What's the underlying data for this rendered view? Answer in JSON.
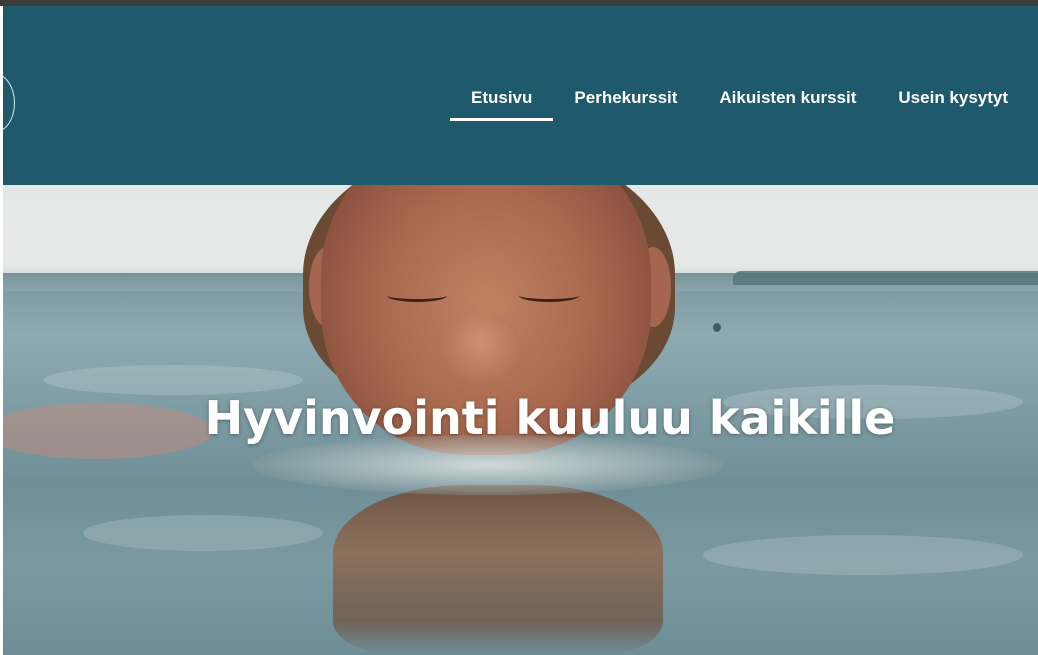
{
  "nav": {
    "items": [
      {
        "label": "Etusivu",
        "active": true
      },
      {
        "label": "Perhekurssit",
        "active": false
      },
      {
        "label": "Aikuisten kurssit",
        "active": false
      },
      {
        "label": "Usein kysytyt",
        "active": false
      }
    ]
  },
  "hero": {
    "title": "Hyvinvointi kuuluu kaikille"
  },
  "colors": {
    "header_bg": "#1e5a6b",
    "nav_text": "#ffffff"
  }
}
